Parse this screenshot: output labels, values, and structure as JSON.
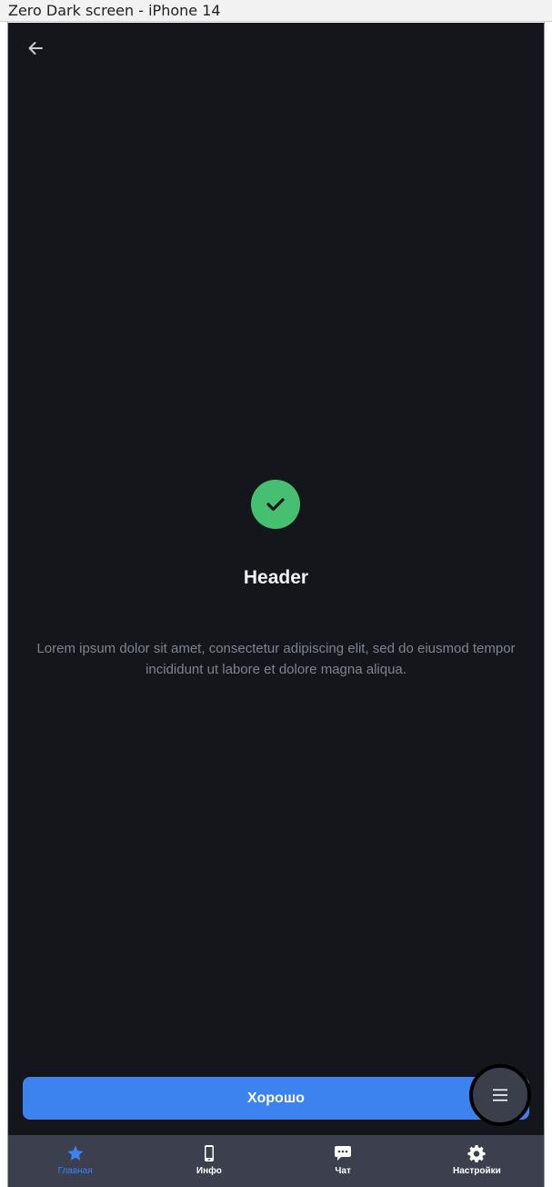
{
  "window": {
    "title": "Zero Dark screen - iPhone 14"
  },
  "screen": {
    "header": "Header",
    "body": "Lorem ipsum dolor sit amet, consectetur adipiscing elit, sed do eiusmod tempor incididunt ut labore et dolore magna aliqua.",
    "primary_button": "Хорошо",
    "icons": {
      "back": "arrow-left-icon",
      "status": "check-circle-icon",
      "fab": "menu-icon"
    }
  },
  "tabbar": {
    "items": [
      {
        "label": "Главная",
        "icon": "star-icon",
        "active": true
      },
      {
        "label": "Инфо",
        "icon": "phone-icon",
        "active": false
      },
      {
        "label": "Чат",
        "icon": "chat-bubble-icon",
        "active": false
      },
      {
        "label": "Настройки",
        "icon": "gear-icon",
        "active": false
      }
    ]
  },
  "colors": {
    "background": "#14161c",
    "accent": "#3c83f0",
    "success": "#46c070",
    "tabbar": "#3c3f4e",
    "muted_text": "#7d8390"
  }
}
